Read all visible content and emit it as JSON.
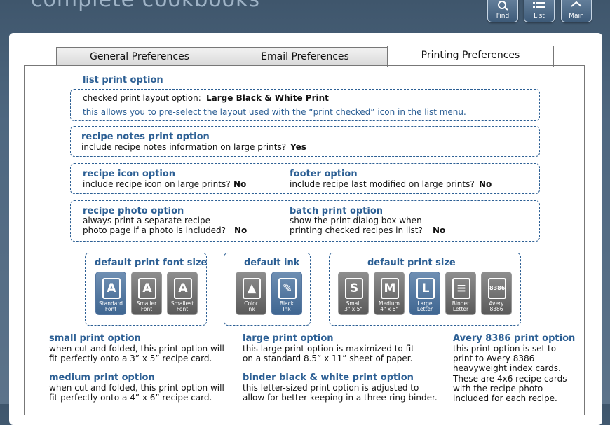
{
  "header": {
    "app_title": "complete cookbooks",
    "buttons": [
      {
        "label": "Find"
      },
      {
        "label": "List"
      },
      {
        "label": "Main"
      }
    ]
  },
  "tabs": [
    {
      "label": "General Preferences"
    },
    {
      "label": "Email Preferences"
    },
    {
      "label": "Printing Preferences"
    }
  ],
  "list_print": {
    "heading": "list print option",
    "prompt": "checked print layout option:",
    "value": "Large Black & White Print",
    "note": "this allows you to pre-select the layout used with the “print checked” icon in the list menu."
  },
  "notes_print": {
    "heading": "recipe notes print option",
    "prompt": "include recipe notes information on large prints?",
    "value": "Yes"
  },
  "icon_option": {
    "heading": "recipe icon option",
    "prompt": "include recipe icon on large prints?",
    "value": "No"
  },
  "footer_option": {
    "heading": "footer option",
    "prompt": "include recipe last modified on large prints?",
    "value": "No"
  },
  "photo_option": {
    "heading": "recipe photo option",
    "line1": "always print a separate recipe",
    "line2": "photo page if a photo is included?",
    "value": "No"
  },
  "batch_option": {
    "heading": "batch print option",
    "line1": "show the print dialog box when",
    "line2": "printing checked recipes in list?",
    "value": "No"
  },
  "font_size": {
    "heading": "default print font size",
    "items": [
      {
        "glyph": "A",
        "cap1": "Standard",
        "cap2": "Font",
        "selected": true
      },
      {
        "glyph": "A",
        "cap1": "Smaller",
        "cap2": "Font",
        "selected": false
      },
      {
        "glyph": "A",
        "cap1": "Smallest",
        "cap2": "Font",
        "selected": false
      }
    ]
  },
  "ink": {
    "heading": "default ink",
    "items": [
      {
        "glyph": "▲",
        "cap1": "Color",
        "cap2": "Ink",
        "selected": false
      },
      {
        "glyph": "✎",
        "cap1": "Black",
        "cap2": "Ink",
        "selected": true
      }
    ]
  },
  "print_size": {
    "heading": "default print size",
    "items": [
      {
        "glyph": "S",
        "cap1": "Small",
        "cap2": "3\" x 5\"",
        "selected": false
      },
      {
        "glyph": "M",
        "cap1": "Medium",
        "cap2": "4\" x 6\"",
        "selected": false
      },
      {
        "glyph": "L",
        "cap1": "Large",
        "cap2": "Letter",
        "selected": true
      },
      {
        "glyph": "≡",
        "cap1": "Binder",
        "cap2": "Letter",
        "selected": false
      },
      {
        "glyph": "8386",
        "cap1": "Avery",
        "cap2": "8386",
        "selected": false
      }
    ]
  },
  "descriptions": {
    "small": {
      "heading": "small print option",
      "line1": "when cut and folded, this print option will",
      "line2": "fit perfectly onto a 3” x 5” recipe card."
    },
    "medium": {
      "heading": "medium print option",
      "line1": "when cut and folded, this print option will",
      "line2": "fit perfectly onto a 4” x 6” recipe card."
    },
    "large": {
      "heading": "large print option",
      "line1": "this large print option is maximized to fit",
      "line2": "on a standard 8.5” x 11” sheet of paper."
    },
    "binder": {
      "heading": "binder black & white print option",
      "line1": "this letter-sized print option is adjusted to",
      "line2": "allow for better keeping in a three-ring binder."
    },
    "avery": {
      "heading": "Avery 8386 print option",
      "lines": [
        "this print option is set to",
        "print to Avery 8386",
        "heavyweight index cards.",
        "These are 4x6 recipe cards",
        "with the recipe photo",
        "included for each recipe."
      ]
    }
  }
}
